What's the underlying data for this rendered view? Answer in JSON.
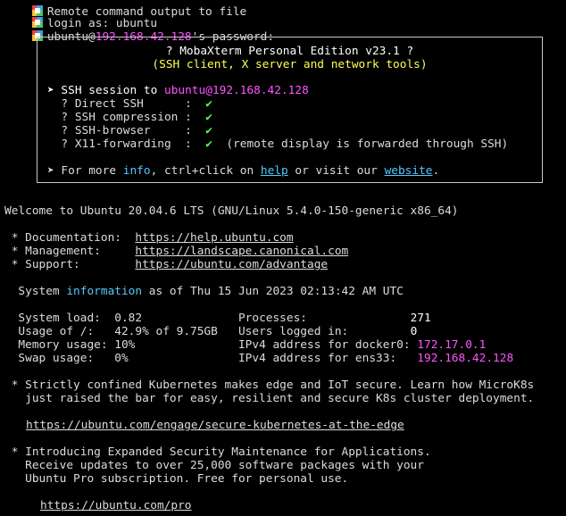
{
  "header": {
    "line0_partial": "Remote command output to file",
    "login_line": "login as: ubuntu",
    "pw_user": "ubuntu@",
    "pw_ip": "192.168.42.128",
    "pw_suffix": "'s password:"
  },
  "banner": {
    "title": "? MobaXterm Personal Edition v23.1 ?",
    "subtitle": "(SSH client, X server and network tools)",
    "session_prefix": "➤ SSH session to ",
    "session_target": "ubuntu@192.168.42.128",
    "items": [
      {
        "label": "  ? Direct SSH      :  ",
        "check": "✔",
        "note": ""
      },
      {
        "label": "  ? SSH compression :  ",
        "check": "✔",
        "note": ""
      },
      {
        "label": "  ? SSH-browser     :  ",
        "check": "✔",
        "note": ""
      },
      {
        "label": "  ? X11-forwarding  :  ",
        "check": "✔",
        "note": "  (remote display is forwarded through SSH)"
      }
    ],
    "more_prefix": "➤ For more ",
    "more_info": "info",
    "more_mid": ", ctrl+click on ",
    "more_help": "help",
    "more_or": " or visit our ",
    "more_website": "website",
    "more_end": "."
  },
  "motd": {
    "welcome": "Welcome to Ubuntu 20.04.6 LTS (GNU/Linux 5.4.0-150-generic x86_64)",
    "links": [
      {
        "label": " * Documentation:  ",
        "url": "https://help.ubuntu.com"
      },
      {
        "label": " * Management:     ",
        "url": "https://landscape.canonical.com"
      },
      {
        "label": " * Support:        ",
        "url": "https://ubuntu.com/advantage"
      }
    ],
    "sysinfo_prefix": "  System ",
    "sysinfo_word": "information",
    "sysinfo_suffix": " as of Thu 15 Jun 2023 02:13:42 AM UTC",
    "stats": [
      {
        "left": "  System load:  0.82              ",
        "right": "Processes:               ",
        "value": "271",
        "vcolor": "w"
      },
      {
        "left": "  Usage of /:   42.9% of 9.75GB   ",
        "right": "Users logged in:         ",
        "value": "0",
        "vcolor": "w"
      },
      {
        "left": "  Memory usage: 10%               ",
        "right": "IPv4 address for docker0: ",
        "value": "172.17.0.1",
        "vcolor": "m"
      },
      {
        "left": "  Swap usage:   0%                ",
        "right": "IPv4 address for ens33:   ",
        "value": "192.168.42.128",
        "vcolor": "m"
      }
    ],
    "k8s_line1": " * Strictly confined Kubernetes makes edge and IoT secure. Learn how MicroK8s",
    "k8s_line2": "   just raised the bar for easy, resilient and secure K8s cluster deployment.",
    "k8s_url": "https://ubuntu.com/engage/secure-kubernetes-at-the-edge",
    "esm_line1": " * Introducing Expanded Security Maintenance for Applications.",
    "esm_line2": "   Receive updates to over 25,000 software packages with your",
    "esm_line3": "   Ubuntu Pro subscription. Free for personal use.",
    "pro_url": "https://ubuntu.com/pro"
  }
}
